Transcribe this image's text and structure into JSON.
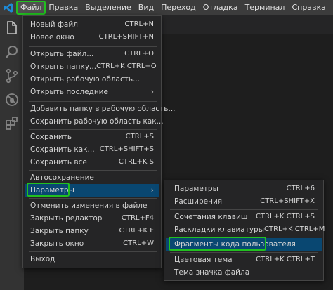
{
  "menubar": {
    "items": [
      "Файл",
      "Правка",
      "Выделение",
      "Вид",
      "Переход",
      "Отладка",
      "Терминал",
      "Справка"
    ]
  },
  "file_menu": {
    "items": [
      {
        "label": "Новый файл",
        "key": "CTRL+N"
      },
      {
        "label": "Новое окно",
        "key": "CTRL+SHIFT+N"
      },
      {
        "label": "Открыть файл...",
        "key": "CTRL+O"
      },
      {
        "label": "Открыть папку...",
        "key": "CTRL+K CTRL+O"
      },
      {
        "label": "Открыть рабочую область...",
        "key": ""
      },
      {
        "label": "Открыть последние",
        "key": ""
      },
      {
        "label": "Добавить папку в рабочую область...",
        "key": ""
      },
      {
        "label": "Сохранить рабочую область как...",
        "key": ""
      },
      {
        "label": "Сохранить",
        "key": "CTRL+S"
      },
      {
        "label": "Сохранить как...",
        "key": "CTRL+SHIFT+S"
      },
      {
        "label": "Сохранить все",
        "key": "CTRL+K S"
      },
      {
        "label": "Автосохранение",
        "key": ""
      },
      {
        "label": "Параметры",
        "key": ""
      },
      {
        "label": "Отменить изменения в файле",
        "key": ""
      },
      {
        "label": "Закрыть редактор",
        "key": "CTRL+F4"
      },
      {
        "label": "Закрыть папку",
        "key": "CTRL+K F"
      },
      {
        "label": "Закрыть окно",
        "key": "CTRL+W"
      },
      {
        "label": "Выход",
        "key": ""
      }
    ]
  },
  "preferences_submenu": {
    "items": [
      {
        "label": "Параметры",
        "key": "CTRL+6"
      },
      {
        "label": "Расширения",
        "key": "CTRL+SHIFT+X"
      },
      {
        "label": "Сочетания клавиш",
        "key": "CTRL+K CTRL+S"
      },
      {
        "label": "Раскладки клавиатуры",
        "key": "CTRL+K CTRL+M"
      },
      {
        "label": "Фрагменты кода пользователя",
        "key": ""
      },
      {
        "label": "Цветовая тема",
        "key": "CTRL+K CTRL+T"
      },
      {
        "label": "Тема значка файла",
        "key": ""
      }
    ]
  },
  "colors": {
    "highlight": "#094771",
    "outline": "#22c020",
    "menu_bg": "#252526"
  }
}
